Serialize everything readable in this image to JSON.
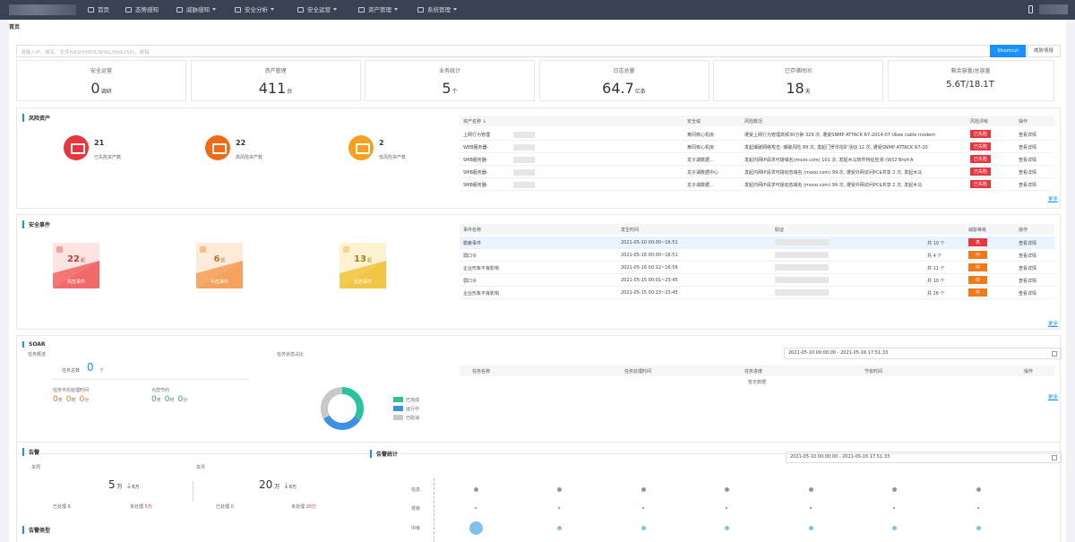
{
  "nav": {
    "items": [
      {
        "label": "首页",
        "caret": false,
        "icon": "home-icon"
      },
      {
        "label": "态势感知",
        "caret": false,
        "icon": "monitor-icon"
      },
      {
        "label": "威胁感知",
        "caret": true,
        "icon": "trend-icon"
      },
      {
        "label": "安全分析",
        "caret": true,
        "icon": "chart-icon"
      },
      {
        "label": "安全运营",
        "caret": true,
        "icon": "screen-icon"
      },
      {
        "label": "资产管理",
        "caret": true,
        "icon": "gear-icon"
      },
      {
        "label": "系统管理",
        "caret": true,
        "icon": "settings-icon"
      }
    ]
  },
  "breadcrumb": "首页",
  "search": {
    "placeholder": "请输入IP、域名、文件HASH(MD5/SHA1/SHA256)、邮箱",
    "button": "Shortcut",
    "intel_button": "威胁情报"
  },
  "stats": [
    {
      "label": "安全运营",
      "value": "0",
      "unit": "调研"
    },
    {
      "label": "资产管理",
      "value": "411",
      "unit": "台"
    },
    {
      "label": "业务统计",
      "value": "5",
      "unit": "个"
    },
    {
      "label": "日志总量",
      "value": "64.7",
      "unit": "亿条"
    },
    {
      "label": "已存储时间",
      "value": "18",
      "unit": "天"
    },
    {
      "label": "剩余容量/总容量",
      "value": "5.6T/18.1T",
      "unit": ""
    }
  ],
  "risk_assets": {
    "title": "风险资产",
    "summary": [
      {
        "count": "21",
        "label": "已失陷资产数",
        "color": "#e8353e"
      },
      {
        "count": "22",
        "label": "高风险资产数",
        "color": "#f06a1a"
      },
      {
        "count": "2",
        "label": "低风险资产数",
        "color": "#f5a01f"
      }
    ],
    "columns": [
      "资产名称 ↓",
      "安全域",
      "风险概况",
      "风险评级",
      "操作"
    ],
    "rows": [
      {
        "name": "上网行为管理",
        "domain": "黄冈核心机房",
        "risk": "遭受上网行为管理高频30分钟 329 次, 遭受SNMP ATTACK R7-2014-07 Ubee cable modem",
        "level": "已失陷",
        "op": "查看详情"
      },
      {
        "name": "WEB服务器-",
        "domain": "黄冈核心机房",
        "risk": "发起爆破网络攻击: 爆破风险 89 次, 发起门罗币挖矿活动 12 次, 遭受SNMP ATTACK R7-20",
        "level": "已失陷",
        "op": "查看详情"
      },
      {
        "name": "SMB服务器-",
        "domain": "龙子湖数据...",
        "risk": "发起内网IP请求可疑域名(mooo.com) 101 次, 发起木马软件特征检测 (W32 Brolf-A",
        "level": "已失陷",
        "op": "查看详情"
      },
      {
        "name": "SMB服务器-",
        "domain": "龙子湖数据中心",
        "risk": "发起内网IP请求可疑动态域名 (mooo.com) 99 次, 遭受外网访问PC$共享 2 次, 发起木马",
        "level": "已失陷",
        "op": "查看详情"
      },
      {
        "name": "SMB服务器-",
        "domain": "龙子湖数据...",
        "risk": "发起内网IP请求可疑动态域名 (mooo.com) 99 次, 遭受外网访问PC$共享 2 次, 发起木马",
        "level": "已失陷",
        "op": "查看详情"
      }
    ],
    "more": "更多"
  },
  "events": {
    "title": "安全事件",
    "cards": [
      {
        "count": "22",
        "unit": "起",
        "label": "高危事件"
      },
      {
        "count": "6",
        "unit": "起",
        "label": "中危事件"
      },
      {
        "count": "13",
        "unit": "起",
        "label": "低危事件"
      }
    ],
    "columns": [
      "事件名称",
      "发生时间",
      "取证",
      "威胁等级",
      "操作"
    ],
    "rows": [
      {
        "name": "勒索事件",
        "time": "2021-05-10 00:00~16:51",
        "count": "共 10 个",
        "level": "高",
        "op": "查看详情"
      },
      {
        "name": "弱口令",
        "time": "2021-05-16 00:00~16:51",
        "count": "共 4 个",
        "level": "中",
        "op": "查看详情"
      },
      {
        "name": "企业形象不良影响",
        "time": "2021-05-16 00:12~16:56",
        "count": "共 11 个",
        "level": "中",
        "op": "查看详情"
      },
      {
        "name": "弱口令",
        "time": "2021-05-15 00:01~23:45",
        "count": "共 10 个",
        "level": "中",
        "op": "查看详情"
      },
      {
        "name": "企业形象不良影响",
        "time": "2021-05-15 00:23~23:45",
        "count": "共 26 个",
        "level": "中",
        "op": "查看详情"
      }
    ],
    "more": "更多"
  },
  "soar": {
    "title": "SOAR",
    "overview_label": "任务概述",
    "task_total_label": "任务总数",
    "task_total": "0",
    "task_total_unit": "个",
    "avg_label": "任务平均处理时间",
    "avg": [
      {
        "v": "0",
        "u": "天"
      },
      {
        "v": "0",
        "u": "时"
      },
      {
        "v": "0",
        "u": "分"
      }
    ],
    "saved_label": "为您节约",
    "saved": [
      {
        "v": "0",
        "u": "天"
      },
      {
        "v": "0",
        "u": "时"
      },
      {
        "v": "0",
        "u": "分"
      }
    ],
    "status_label": "任务状态占比",
    "legend": [
      {
        "label": "已完成",
        "color": "#2bc39a"
      },
      {
        "label": "运行中",
        "color": "#3f8fe6"
      },
      {
        "label": "已取消",
        "color": "#c8c8c8"
      }
    ],
    "donut": [
      0.34,
      0.33,
      0.33
    ],
    "date_range": "2021-05-10 00:00:00 - 2021-05-16 17:51:33",
    "columns": [
      "任务名称",
      "任务处理时间",
      "任务进度",
      "节省时间",
      "操作"
    ],
    "empty": "暂无数据",
    "more": "更多"
  },
  "alerts": {
    "title": "告警",
    "today_label": "本周",
    "yesterday_label": "本月",
    "left": {
      "value": "5",
      "unit": "万",
      "delta": "↓",
      "delta_val": "6万",
      "handled_label": "已处理",
      "handled": "8",
      "unhandled_label": "未处理",
      "unhandled": "5万"
    },
    "right": {
      "value": "20",
      "unit": "万",
      "delta": "↓",
      "delta_val": "6万",
      "handled_label": "已处理",
      "handled": "0",
      "unhandled_label": "未处理",
      "unhandled": "20万"
    },
    "stats_title": "告警统计",
    "date_range": "2021-05-10 00:00:00 - 2021-05-16 17:51:33",
    "row_labels": [
      "信息",
      "低级",
      "中级"
    ],
    "type_title": "告警类型",
    "bubbles": [
      [
        2,
        2,
        2,
        2,
        2,
        2,
        2
      ],
      [
        1,
        1,
        1,
        1,
        1,
        1,
        1
      ],
      [
        6,
        2,
        2,
        2,
        2,
        2,
        2
      ]
    ]
  }
}
